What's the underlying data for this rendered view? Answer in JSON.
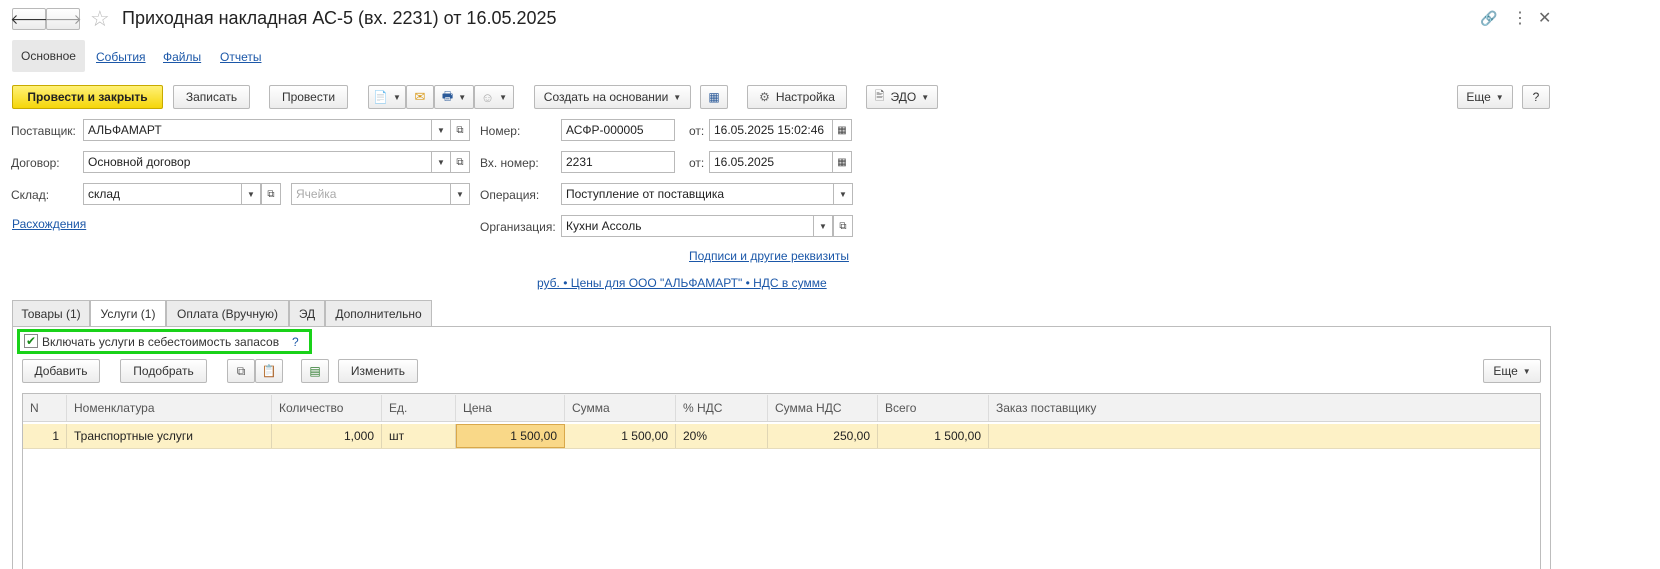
{
  "window": {
    "title": "Приходная накладная АС-5 (вх. 2231) от 16.05.2025"
  },
  "nav_tabs": [
    "Основное",
    "События",
    "Файлы",
    "Отчеты"
  ],
  "toolbar": {
    "post_close": "Провести и закрыть",
    "save": "Записать",
    "post": "Провести",
    "create_based": "Создать на основании",
    "settings": "Настройка",
    "edo": "ЭДО",
    "more": "Еще",
    "help": "?"
  },
  "form": {
    "supplier_label": "Поставщик:",
    "supplier_value": "АЛЬФАМАРТ",
    "contract_label": "Договор:",
    "contract_value": "Основной договор",
    "warehouse_label": "Склад:",
    "warehouse_value": "склад",
    "cell_placeholder": "Ячейка",
    "discrepancies_link": "Расхождения",
    "number_label": "Номер:",
    "number_value": "АСФР-000005",
    "from_label": "от:",
    "number_date": "16.05.2025 15:02:46",
    "in_number_label": "Вх. номер:",
    "in_number_value": "2231",
    "in_number_date": "16.05.2025",
    "operation_label": "Операция:",
    "operation_value": "Поступление от поставщика",
    "org_label": "Организация:",
    "org_value": "Кухни Ассоль",
    "signatures_link": "Подписи и другие реквизиты",
    "prices_link": "руб. • Цены для ООО \"АЛЬФАМАРТ\" • НДС в сумме"
  },
  "doc_tabs": [
    "Товары (1)",
    "Услуги (1)",
    "Оплата (Вручную)",
    "ЭД",
    "Дополнительно"
  ],
  "services": {
    "include_checkbox_label": "Включать услуги в себестоимость запасов",
    "include_checked": true,
    "help_mark": "?",
    "add": "Добавить",
    "pick": "Подобрать",
    "change": "Изменить",
    "more": "Еще"
  },
  "table": {
    "columns": [
      "N",
      "Номенклатура",
      "Количество",
      "Ед.",
      "Цена",
      "Сумма",
      "% НДС",
      "Сумма НДС",
      "Всего",
      "Заказ поставщику"
    ],
    "rows": [
      {
        "n": "1",
        "item": "Транспортные услуги",
        "qty": "1,000",
        "unit": "шт",
        "price": "1 500,00",
        "sum": "1 500,00",
        "vat_rate": "20%",
        "vat_sum": "250,00",
        "total": "1 500,00",
        "order": ""
      }
    ]
  },
  "colors": {
    "accent_yellow": "#f5d60a",
    "highlight_row": "#fdf1c6",
    "link": "#1b57a8",
    "focus_frame": "#19d219"
  }
}
